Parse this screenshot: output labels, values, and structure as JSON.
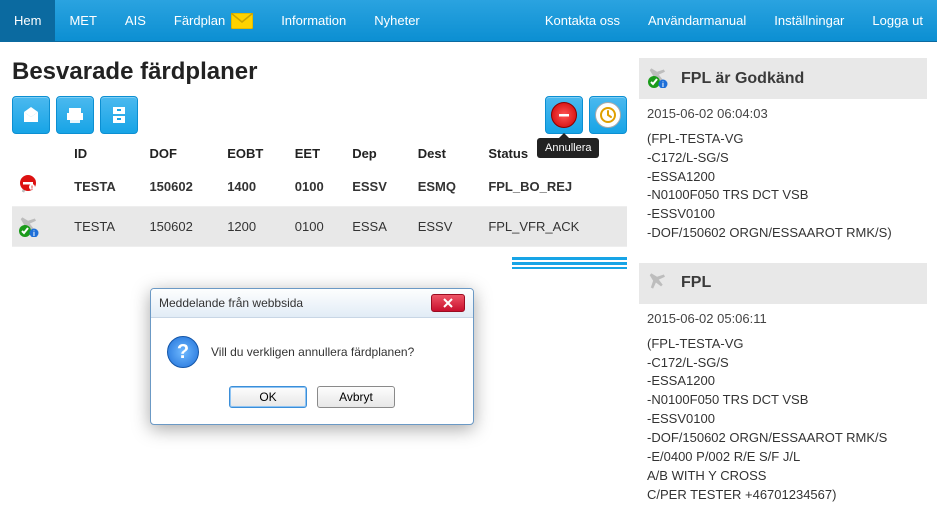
{
  "nav": {
    "left": [
      "Hem",
      "MET",
      "AIS",
      "Färdplan",
      "Information",
      "Nyheter"
    ],
    "right": [
      "Kontakta oss",
      "Användarmanual",
      "Inställningar",
      "Logga ut"
    ]
  },
  "page_title": "Besvarade färdplaner",
  "tooltip_cancel": "Annullera",
  "table": {
    "headers": [
      "",
      "ID",
      "DOF",
      "EOBT",
      "EET",
      "Dep",
      "Dest",
      "Status"
    ],
    "rows": [
      {
        "icon": "rejected",
        "id": "TESTA",
        "dof": "150602",
        "eobt": "1400",
        "eet": "0100",
        "dep": "ESSV",
        "dest": "ESMQ",
        "status": "FPL_BO_REJ",
        "selected": false
      },
      {
        "icon": "approved",
        "id": "TESTA",
        "dof": "150602",
        "eobt": "1200",
        "eet": "0100",
        "dep": "ESSA",
        "dest": "ESSV",
        "status": "FPL_VFR_ACK",
        "selected": true
      }
    ]
  },
  "dialog": {
    "title": "Meddelande från webbsida",
    "message": "Vill du verkligen annullera färdplanen?",
    "ok": "OK",
    "cancel": "Avbryt"
  },
  "side": [
    {
      "icon": "approved",
      "title": "FPL är Godkänd",
      "timestamp": "2015-06-02 06:04:03",
      "lines": [
        "(FPL-TESTA-VG",
        "-C172/L-SG/S",
        "-ESSA1200",
        "-N0100F050 TRS DCT VSB",
        "-ESSV0100",
        "-DOF/150602 ORGN/ESSAAROT RMK/S)"
      ]
    },
    {
      "icon": "plain",
      "title": "FPL",
      "timestamp": "2015-06-02 05:06:11",
      "lines": [
        "(FPL-TESTA-VG",
        "-C172/L-SG/S",
        "-ESSA1200",
        "-N0100F050 TRS DCT VSB",
        "-ESSV0100",
        "-DOF/150602 ORGN/ESSAAROT RMK/S",
        "-E/0400 P/002 R/E S/F J/L",
        "A/B WITH Y CROSS",
        "C/PER TESTER +46701234567)"
      ]
    }
  ]
}
